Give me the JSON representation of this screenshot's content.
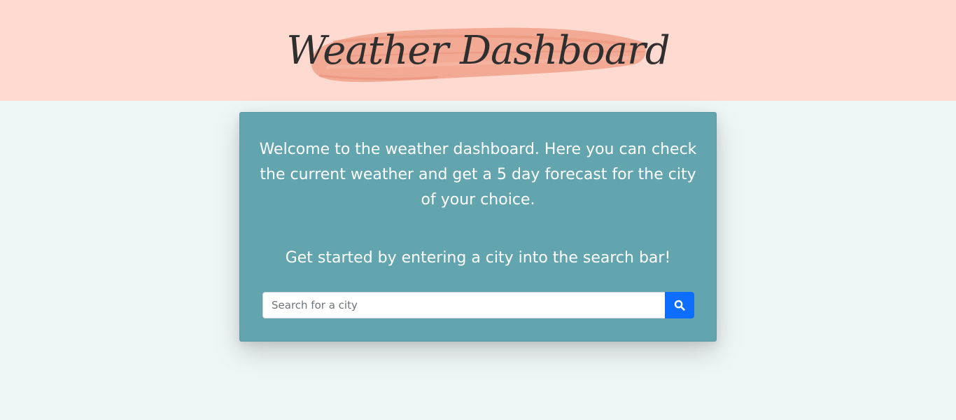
{
  "header": {
    "title": "Weather Dashboard"
  },
  "card": {
    "intro_text": "Welcome to the weather dashboard. Here you can check the current weather and get a 5 day forecast for the city of your choice.",
    "cta_text": "Get started by entering a city into the search bar!"
  },
  "search": {
    "placeholder": "Search for a city",
    "value": "",
    "button_icon": "search-icon"
  },
  "colors": {
    "header_bg": "#ffdad1",
    "brush": "#f2a48e",
    "page_bg": "#eef6f8",
    "card_bg": "#62a5ae",
    "button_bg": "#0d6efd",
    "title_text": "#2f2f2f"
  }
}
